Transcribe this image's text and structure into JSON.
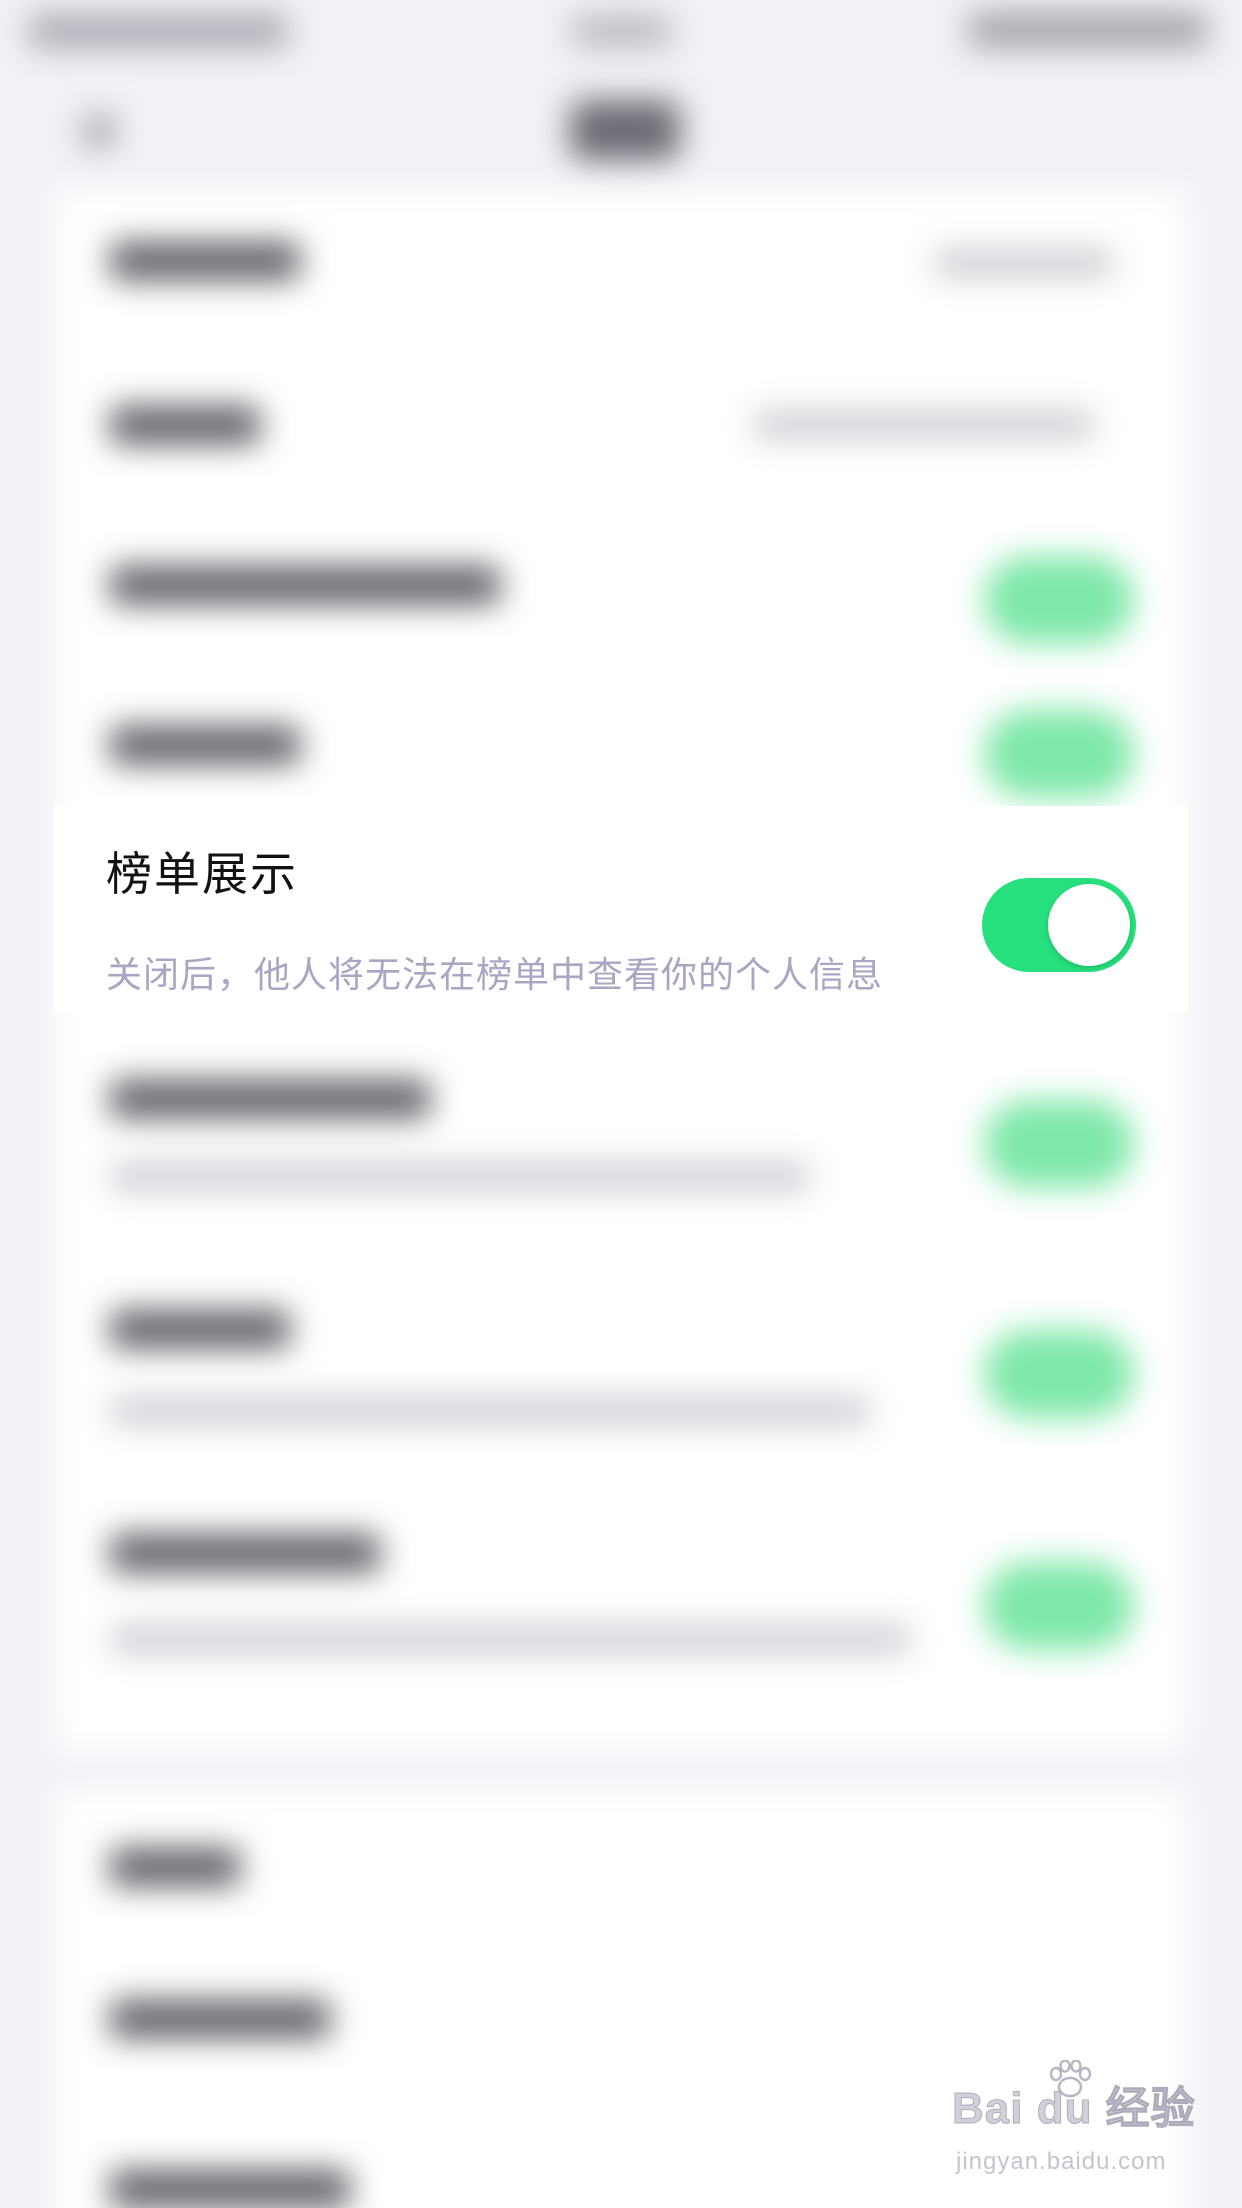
{
  "focused_setting": {
    "title": "榜单展示",
    "description": "关闭后，他人将无法在榜单中查看你的个人信息",
    "toggle_on": true
  },
  "watermark": {
    "brand": "Bai du 经验",
    "url": "jingyan.baidu.com"
  },
  "colors": {
    "background": "#f1f2f7",
    "card": "#ffffff",
    "toggle_on": "#26e07d",
    "description_text": "#a7a7c4",
    "title_text": "#111111"
  }
}
